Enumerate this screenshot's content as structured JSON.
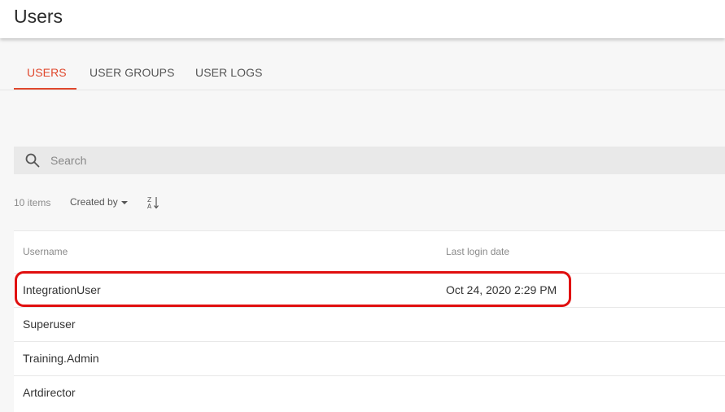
{
  "header": {
    "title": "Users"
  },
  "tabs": [
    {
      "label": "USERS",
      "active": true
    },
    {
      "label": "USER GROUPS",
      "active": false
    },
    {
      "label": "USER LOGS",
      "active": false
    }
  ],
  "search": {
    "placeholder": "Search",
    "value": "",
    "icon": "search-icon"
  },
  "toolbar": {
    "item_count": "10 items",
    "sort_label": "Created by",
    "sort_direction_icon": "sort-z-a-icon"
  },
  "table": {
    "columns": [
      "Username",
      "Last login date"
    ],
    "rows": [
      {
        "username": "IntegrationUser",
        "last_login": "Oct 24, 2020 2:29 PM",
        "highlighted": true
      },
      {
        "username": "Superuser",
        "last_login": ""
      },
      {
        "username": "Training.Admin",
        "last_login": ""
      },
      {
        "username": "Artdirector",
        "last_login": ""
      }
    ]
  },
  "colors": {
    "accent": "#e0472c",
    "highlight": "#e00f0f",
    "background": "#f7f7f7"
  }
}
